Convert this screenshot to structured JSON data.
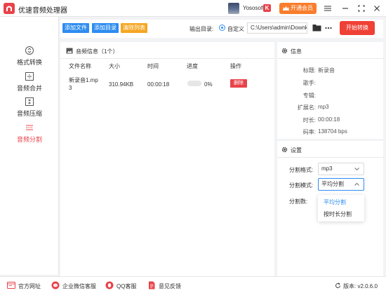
{
  "app": {
    "title": "优速音频处理器",
    "logo_color": "#e8434a"
  },
  "user": {
    "name": "Yososoft",
    "vip_label": "开通会员"
  },
  "sidebar": {
    "items": [
      {
        "label": "格式转换",
        "icon": "format-convert-icon"
      },
      {
        "label": "音频合并",
        "icon": "audio-merge-icon"
      },
      {
        "label": "音频压缩",
        "icon": "audio-compress-icon"
      },
      {
        "label": "音频分割",
        "icon": "audio-split-icon",
        "active": true
      }
    ]
  },
  "toolbar": {
    "add_file_label": "添加文件",
    "add_dir_label": "添加目录",
    "clear_list_label": "清除列表",
    "output_dir_label": "输出目录:",
    "custom_label": "自定义",
    "output_path": "C:\\Users\\admin\\Downk",
    "start_label": "开始转换"
  },
  "list": {
    "title": "音频信息（1个）",
    "columns": {
      "name": "文件名称",
      "size": "大小",
      "time": "时间",
      "progress": "进度",
      "action": "操作"
    },
    "rows": [
      {
        "name": "新录音1.mp3",
        "size": "310.94KB",
        "time": "00:00:18",
        "progress_percent": 0,
        "progress_text": "0%",
        "delete_label": "删除"
      }
    ]
  },
  "info": {
    "title": "信息",
    "fields": [
      {
        "key": "标题:",
        "value": "新录音"
      },
      {
        "key": "歌手:",
        "value": ""
      },
      {
        "key": "专辑:",
        "value": ""
      },
      {
        "key": "扩展名:",
        "value": "mp3"
      },
      {
        "key": "时长:",
        "value": "00:00:18"
      },
      {
        "key": "码率:",
        "value": "138704 bps"
      }
    ]
  },
  "settings": {
    "title": "设置",
    "format_label": "分割格式:",
    "format_value": "mp3",
    "mode_label": "分割模式:",
    "mode_value": "平均分割",
    "count_label": "分割数:",
    "mode_options": [
      "平均分割",
      "按时长分割"
    ]
  },
  "footer": {
    "website_label": "官方网址",
    "wechat_label": "企业微信客服",
    "qq_label": "QQ客服",
    "feedback_label": "意见反馈",
    "version_label": "版本: v2.0.6.0"
  },
  "colors": {
    "accent": "#e8434a",
    "primary": "#2d8cf0",
    "orange": "#f97d2c",
    "warn": "#f5a623"
  }
}
